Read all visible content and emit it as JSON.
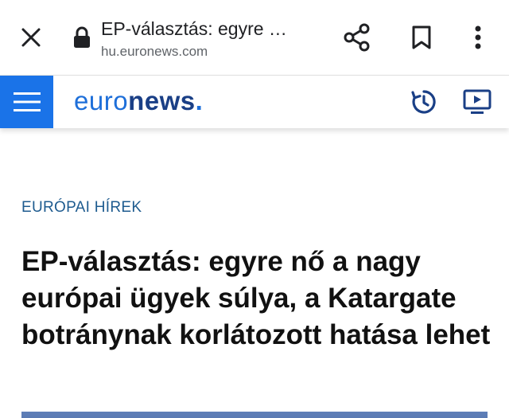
{
  "browser": {
    "page_title": "EP-választás: egyre …",
    "domain": "hu.euronews.com",
    "icons": {
      "close": "close-icon",
      "lock": "lock-icon",
      "share": "share-icon",
      "bookmark": "bookmark-icon",
      "menu": "more-vert-icon"
    }
  },
  "site_header": {
    "logo_light": "euro",
    "logo_bold": "news",
    "logo_dot": ".",
    "icons": {
      "menu": "hamburger-icon",
      "latest": "clock-refresh-icon",
      "live": "tv-play-icon"
    },
    "colors": {
      "menu_bg": "#1a73e8",
      "logo_blue": "#1e6fd9",
      "logo_dark": "#1a3f86"
    }
  },
  "article": {
    "category": "EURÓPAI HÍREK",
    "headline": "EP-választás: egyre nő a nagy európai ügyek súlya, a Katargate botránynak korlátozott hatása lehet"
  }
}
